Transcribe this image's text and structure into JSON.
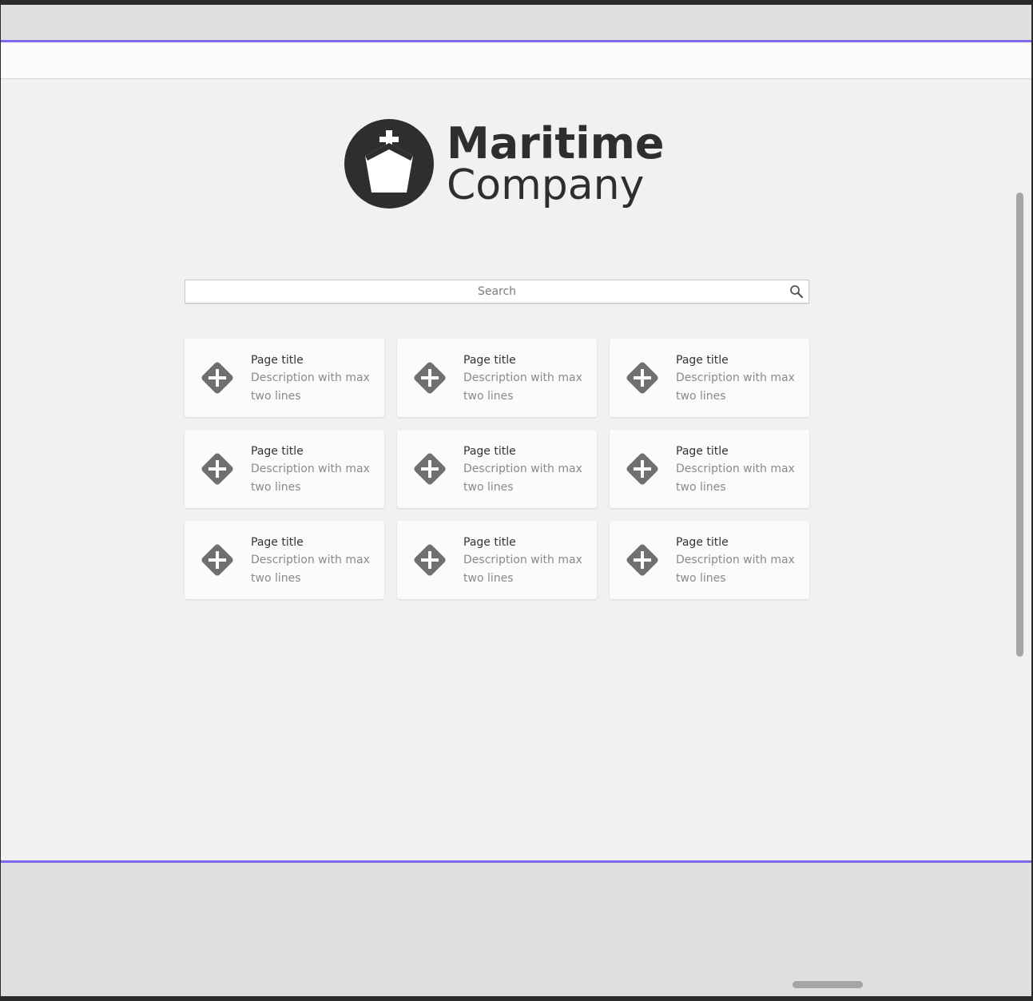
{
  "logo": {
    "line1": "Maritime",
    "line2": "Company",
    "icon": "ship-icon"
  },
  "search": {
    "placeholder": "Search",
    "value": "",
    "icon": "search-icon"
  },
  "cards": [
    {
      "title": "Page title",
      "description": "Description with max two lines",
      "icon": "add-diamond-icon"
    },
    {
      "title": "Page title",
      "description": "Description with max two lines",
      "icon": "add-diamond-icon"
    },
    {
      "title": "Page title",
      "description": "Description with max two lines",
      "icon": "add-diamond-icon"
    },
    {
      "title": "Page title",
      "description": "Description with max two lines",
      "icon": "add-diamond-icon"
    },
    {
      "title": "Page title",
      "description": "Description with max two lines",
      "icon": "add-diamond-icon"
    },
    {
      "title": "Page title",
      "description": "Description with max two lines",
      "icon": "add-diamond-icon"
    },
    {
      "title": "Page title",
      "description": "Description with max two lines",
      "icon": "add-diamond-icon"
    },
    {
      "title": "Page title",
      "description": "Description with max two lines",
      "icon": "add-diamond-icon"
    },
    {
      "title": "Page title",
      "description": "Description with max two lines",
      "icon": "add-diamond-icon"
    }
  ],
  "colors": {
    "accent": "#7b68ee",
    "logo": "#2e2e2e",
    "icon": "#707070"
  }
}
